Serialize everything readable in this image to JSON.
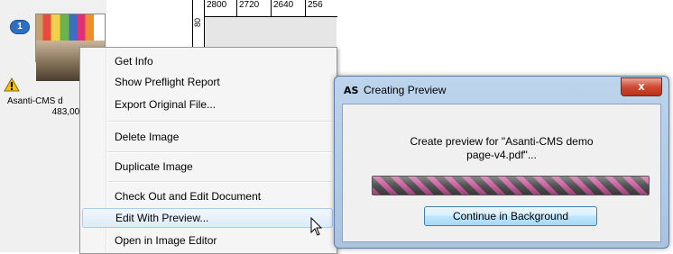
{
  "thumbnail": {
    "badge_number": "1",
    "file_name": "Asanti-CMS d",
    "file_size": "483,00 x"
  },
  "ruler": {
    "ticks": [
      "2800",
      "2720",
      "2640",
      "256"
    ],
    "vertical_label": "80"
  },
  "context_menu": {
    "items": [
      "Get Info",
      "Show Preflight Report",
      "Export Original File...",
      "Delete Image",
      "Duplicate Image",
      "Check Out and Edit Document",
      "Edit With Preview...",
      "Open in Image Editor"
    ],
    "highlighted_index": 6
  },
  "dialog": {
    "app_icon_text": "AS",
    "title": "Creating Preview",
    "close_label": "x",
    "message_line1": "Create preview for \"Asanti-CMS demo",
    "message_line2": "page-v4.pdf\"...",
    "button_label": "Continue in Background",
    "progress_indeterminate": true
  },
  "colors": {
    "badge": "#2c6fc4",
    "progress_stripe": "#c85a9c",
    "close_button": "#cf4a32",
    "menu_highlight_border": "#a8cbf1"
  }
}
